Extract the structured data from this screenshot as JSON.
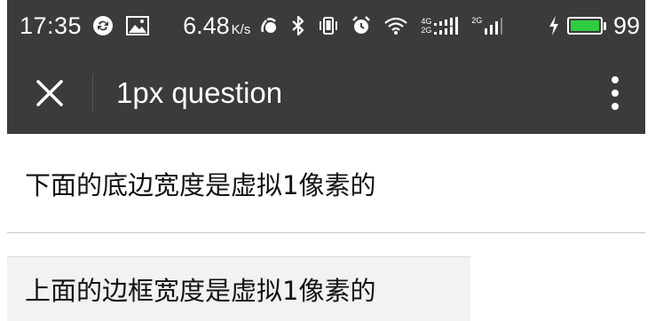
{
  "status_bar": {
    "time": "17:35",
    "network_speed": "6.48",
    "network_speed_unit": "K/s",
    "signal_labels": [
      "4G",
      "2G",
      "2G"
    ],
    "battery_level": "99",
    "battery_color": "#2ecc40",
    "icons": [
      "sync-icon",
      "image-icon",
      "nfc-icon",
      "bluetooth-icon",
      "vibrate-icon",
      "alarm-icon",
      "wifi-icon",
      "signal-icon",
      "charging-icon",
      "battery-icon"
    ]
  },
  "title_bar": {
    "title": "1px question",
    "close_icon": "close-icon",
    "more_icon": "more-vertical-icon",
    "background": "#3b3b3b"
  },
  "content": {
    "row_bottom_text": "下面的底边宽度是虚拟1像素的",
    "row_top_text": "上面的边框宽度是虚拟1像素的"
  }
}
